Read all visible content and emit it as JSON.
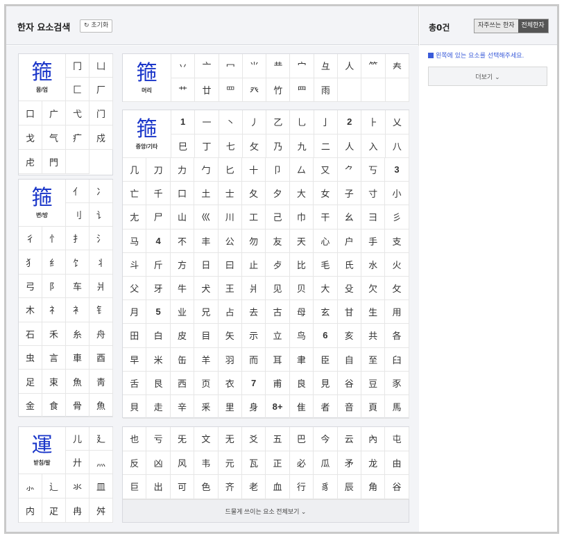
{
  "header": {
    "title": "한자 요소검색",
    "reset_label": "↻ 초기화",
    "count": "총0건",
    "tab_frequent": "자주쓰는 한자",
    "tab_all": "전체한자"
  },
  "notice": "왼쪽에 있는 요소를 선택해주세요.",
  "more_label": "더보기 ⌄",
  "enclosure": {
    "glyph_pre": "箍",
    "label": "몸/엄",
    "side": [
      "冂",
      "凵",
      "匚",
      "厂"
    ],
    "rows": [
      [
        "口",
        "广",
        "弋",
        "门"
      ],
      [
        "戈",
        "气",
        "疒",
        "戍"
      ],
      [
        "虍",
        "門",
        ""
      ]
    ]
  },
  "side_radical": {
    "glyph": "箍",
    "label": "변/방",
    "side": [
      "亻",
      "冫",
      "刂",
      "讠"
    ],
    "rows": [
      [
        "彳",
        "忄",
        "扌",
        "氵"
      ],
      [
        "犭",
        "纟",
        "饣",
        "丬"
      ],
      [
        "弓",
        "阝",
        "车",
        "爿"
      ],
      [
        "木",
        "礻",
        "衤",
        "钅"
      ],
      [
        "石",
        "禾",
        "糸",
        "舟"
      ],
      [
        "虫",
        "言",
        "車",
        "酉"
      ],
      [
        "足",
        "束",
        "魚",
        "靑"
      ],
      [
        "金",
        "食",
        "骨",
        "魚"
      ]
    ]
  },
  "top_radical": {
    "glyph": "箍",
    "label": "머리",
    "row1": [
      "丷",
      "亠",
      "冖",
      "⺌",
      "龷",
      "宀",
      "彑",
      "人",
      "⺮",
      "𡗗"
    ],
    "row2": [
      "艹",
      "廿",
      "罒",
      "癶",
      "竹",
      "⺫",
      "雨",
      "",
      "",
      ""
    ]
  },
  "center": {
    "glyph": "箍",
    "label": "중앙/기타",
    "row1": [
      {
        "t": "1",
        "n": true
      },
      "一",
      "丶",
      "丿",
      "乙",
      "乚",
      "亅",
      {
        "t": "2",
        "n": true
      },
      "⺊",
      "乂"
    ],
    "row2": [
      "巳",
      "丁",
      "七",
      "攵",
      "乃",
      "九",
      "二",
      "人",
      "入",
      "八"
    ],
    "rows": [
      [
        "几",
        "刀",
        "力",
        "勹",
        "匕",
        "十",
        "卩",
        "厶",
        "又",
        "⺈",
        "丂",
        {
          "t": "3",
          "n": true
        }
      ],
      [
        "亡",
        "千",
        "口",
        "土",
        "士",
        "夂",
        "夕",
        "大",
        "女",
        "子",
        "寸",
        "小"
      ],
      [
        "尢",
        "尸",
        "山",
        "巛",
        "川",
        "工",
        "己",
        "巾",
        "干",
        "幺",
        "彐",
        "彡"
      ],
      [
        "马",
        {
          "t": "4",
          "n": true
        },
        "不",
        "丰",
        "公",
        "勿",
        "友",
        "天",
        "心",
        "户",
        "手",
        "支"
      ],
      [
        "斗",
        "斤",
        "方",
        "日",
        "曰",
        "止",
        "歺",
        "比",
        "毛",
        "氏",
        "水",
        "火"
      ],
      [
        "父",
        "牙",
        "牛",
        "犬",
        "王",
        "爿",
        "见",
        "贝",
        "大",
        "殳",
        "欠",
        "攵"
      ],
      [
        "月",
        {
          "t": "5",
          "n": true
        },
        "业",
        "兄",
        "占",
        "去",
        "古",
        "母",
        "玄",
        "甘",
        "生",
        "用"
      ],
      [
        "田",
        "白",
        "皮",
        "目",
        "矢",
        "示",
        "立",
        "鸟",
        {
          "t": "6",
          "n": true
        },
        "亥",
        "共",
        "各"
      ],
      [
        "早",
        "米",
        "缶",
        "羊",
        "羽",
        "而",
        "耳",
        "聿",
        "臣",
        "自",
        "至",
        "臼"
      ],
      [
        "舌",
        "艮",
        "西",
        "页",
        "衣",
        {
          "t": "7",
          "n": true
        },
        "甫",
        "良",
        "見",
        "谷",
        "豆",
        "豕"
      ],
      [
        "貝",
        "走",
        "辛",
        "釆",
        "里",
        "身",
        {
          "t": "8+",
          "n": true
        },
        "隹",
        "者",
        "音",
        "頁",
        "馬"
      ]
    ]
  },
  "bottom_radical": {
    "glyph_pre": "運",
    "label": "받침/발",
    "side": [
      "儿",
      "廴",
      "廾",
      "灬"
    ],
    "rows": [
      [
        "⺗",
        "辶",
        "氺",
        "皿"
      ],
      [
        "内",
        "疋",
        "冉",
        "舛"
      ]
    ]
  },
  "rare": {
    "rows": [
      [
        "也",
        "亏",
        "旡",
        "文",
        "无",
        "爻",
        "五",
        "巴",
        "今",
        "云",
        "內",
        "屯"
      ],
      [
        "反",
        "凶",
        "风",
        "韦",
        "元",
        "瓦",
        "正",
        "必",
        "瓜",
        "矛",
        "龙",
        "由"
      ],
      [
        "巨",
        "出",
        "可",
        "色",
        "齐",
        "老",
        "血",
        "行",
        "豸",
        "辰",
        "角",
        "谷"
      ]
    ],
    "more_label": "드물게 쓰이는 요소 전체보기 ⌄"
  }
}
